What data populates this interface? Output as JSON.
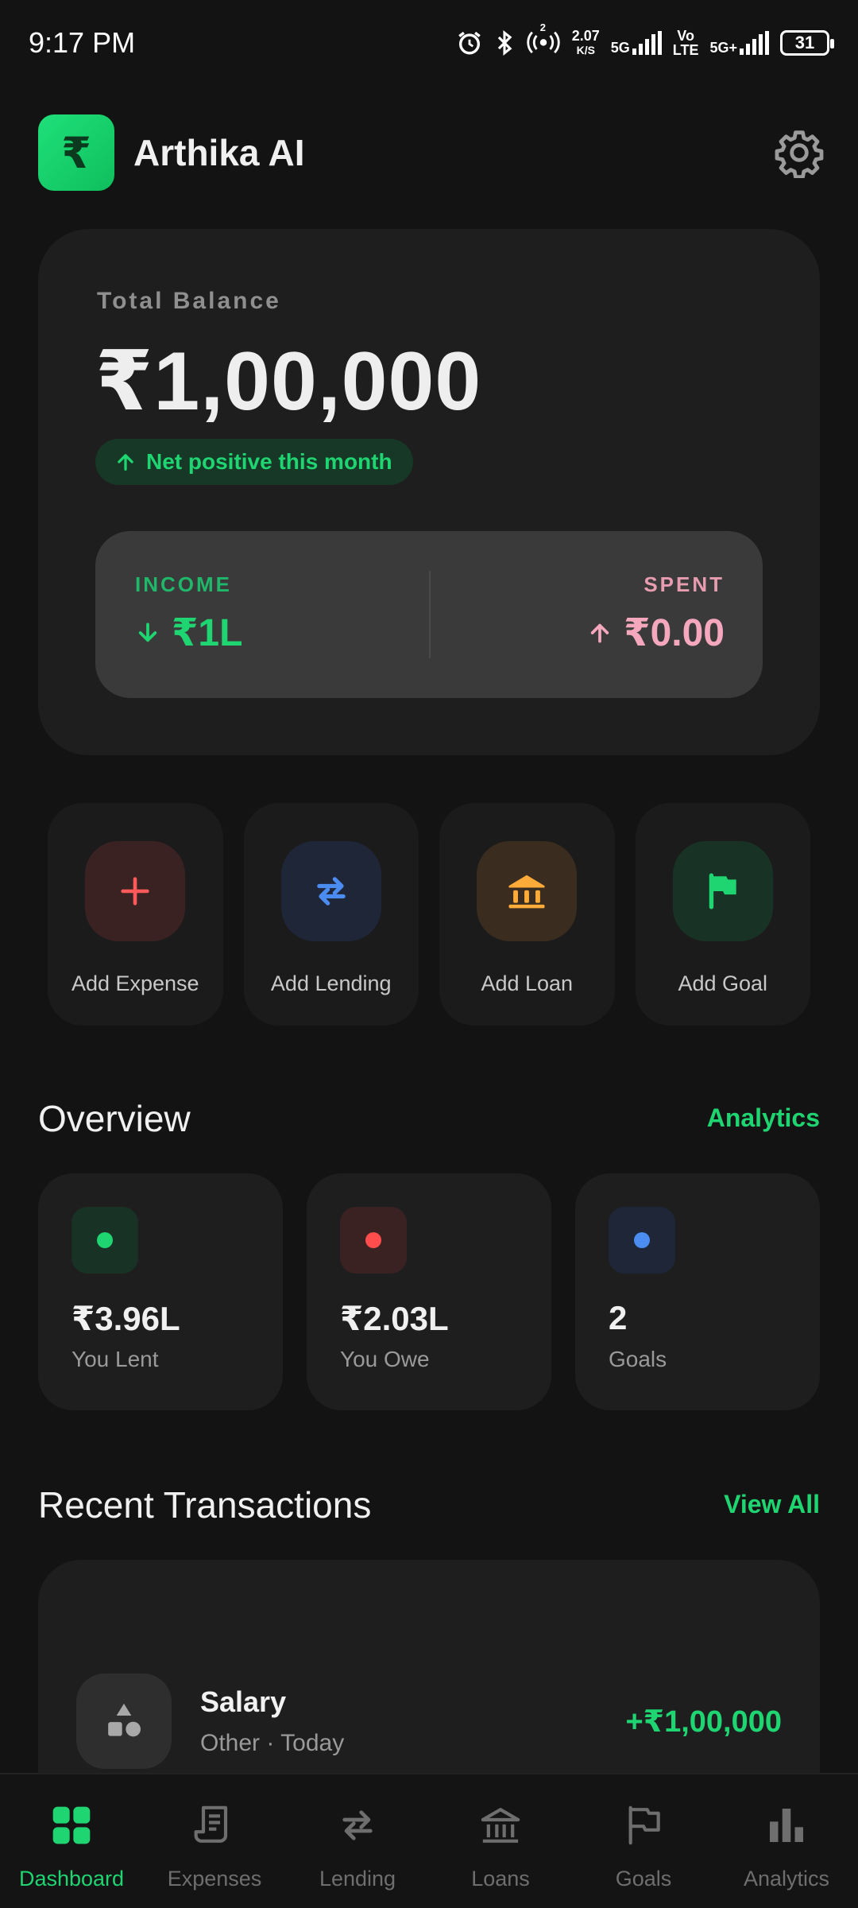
{
  "status_bar": {
    "time": "9:17 PM",
    "net_speed_value": "2.07",
    "net_speed_unit": "K/S",
    "sim1_label": "5G",
    "volte_top": "Vo",
    "volte_bottom": "LTE",
    "sim2_label": "5G+",
    "battery": "31",
    "hotspot_badge": "2"
  },
  "header": {
    "logo_glyph": "₹",
    "title": "Arthika AI"
  },
  "balance": {
    "label": "Total Balance",
    "amount": "₹1,00,000",
    "badge": "Net positive this month",
    "income_label": "INCOME",
    "income_value": "₹1L",
    "spent_label": "SPENT",
    "spent_value": "₹0.00"
  },
  "quick_actions": [
    {
      "label": "Add Expense",
      "icon": "plus-icon",
      "color": "#ff5a5a"
    },
    {
      "label": "Add Lending",
      "icon": "swap-arrows-icon",
      "color": "#4a8cf0"
    },
    {
      "label": "Add Loan",
      "icon": "bank-icon",
      "color": "#ffab3a"
    },
    {
      "label": "Add Goal",
      "icon": "flag-icon",
      "color": "#1fd572"
    }
  ],
  "overview": {
    "title": "Overview",
    "link": "Analytics",
    "cards": [
      {
        "value": "₹3.96L",
        "label": "You Lent",
        "dot_color": "#1fd572"
      },
      {
        "value": "₹2.03L",
        "label": "You Owe",
        "dot_color": "#ff4d4d"
      },
      {
        "value": "2",
        "label": "Goals",
        "dot_color": "#4a8cf0"
      }
    ]
  },
  "transactions": {
    "title": "Recent Transactions",
    "link": "View All",
    "items": [
      {
        "name": "Salary",
        "meta": "Other · Today",
        "amount": "+₹1,00,000",
        "icon": "shapes-icon"
      }
    ]
  },
  "nav": [
    {
      "label": "Dashboard",
      "icon": "dashboard-grid-icon",
      "active": true
    },
    {
      "label": "Expenses",
      "icon": "receipt-icon",
      "active": false
    },
    {
      "label": "Lending",
      "icon": "swap-arrows-icon",
      "active": false
    },
    {
      "label": "Loans",
      "icon": "bank-icon",
      "active": false
    },
    {
      "label": "Goals",
      "icon": "flag-icon",
      "active": false
    },
    {
      "label": "Analytics",
      "icon": "bar-chart-icon",
      "active": false
    }
  ],
  "colors": {
    "accent": "#1fd572",
    "background": "#131313",
    "card": "#1e1e1e",
    "spent": "#f4a7bd"
  }
}
